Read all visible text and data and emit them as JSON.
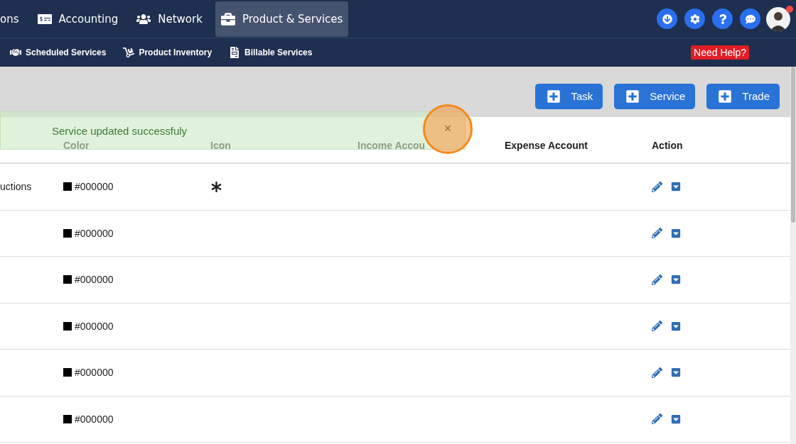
{
  "top_nav": [
    {
      "label": "ons",
      "selected": false
    },
    {
      "label": "Accounting",
      "selected": false
    },
    {
      "label": "Network",
      "selected": false
    },
    {
      "label": "Product & Services",
      "selected": true
    }
  ],
  "sub_nav": [
    {
      "label": "Scheduled Services"
    },
    {
      "label": "Product Inventory"
    },
    {
      "label": "Billable Services"
    }
  ],
  "help_badge": "Need Help?",
  "action_buttons": [
    "Task",
    "Service",
    "Trade"
  ],
  "toast": {
    "message": "Service updated successfuly",
    "close": "×"
  },
  "table": {
    "columns": [
      "",
      "Color",
      "Icon",
      "Income Accou",
      "Expense Account",
      "Action"
    ],
    "rows": [
      {
        "column_1": "uctions",
        "color": "#000000",
        "color_text": "#000000",
        "has_icon": true
      },
      {
        "column_1": "",
        "color": "#000000",
        "color_text": "#000000",
        "has_icon": false
      },
      {
        "column_1": "",
        "color": "#000000",
        "color_text": "#000000",
        "has_icon": false
      },
      {
        "column_1": "",
        "color": "#000000",
        "color_text": "#000000",
        "has_icon": false
      },
      {
        "column_1": "",
        "color": "#000000",
        "color_text": "#000000",
        "has_icon": false
      },
      {
        "column_1": "",
        "color": "#000000",
        "color_text": "#000000",
        "has_icon": false
      }
    ]
  }
}
